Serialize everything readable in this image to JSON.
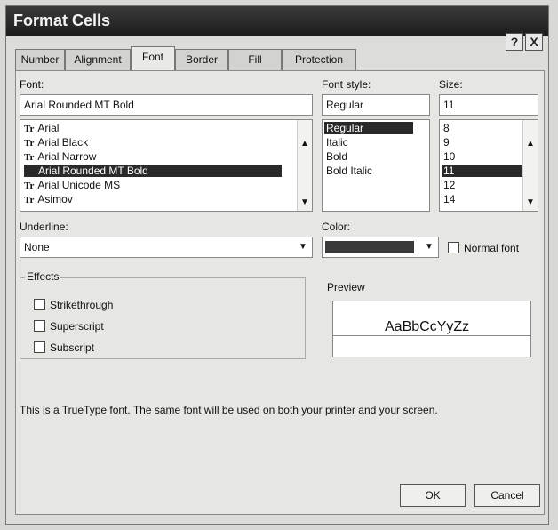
{
  "dialog": {
    "title": "Format Cells",
    "help_label": "?",
    "close_label": "X"
  },
  "tabs": [
    {
      "label": "Number"
    },
    {
      "label": "Alignment"
    },
    {
      "label": "Font"
    },
    {
      "label": "Border"
    },
    {
      "label": "Fill"
    },
    {
      "label": "Protection"
    }
  ],
  "font": {
    "label": "Font:",
    "value": "Arial Rounded MT Bold",
    "items": [
      "Arial",
      "Arial Black",
      "Arial Narrow",
      "Arial Rounded MT Bold",
      "Arial Unicode MS",
      "Asimov"
    ],
    "icon_glyph": "Tr"
  },
  "font_style": {
    "label": "Font style:",
    "value": "Regular",
    "items": [
      "Regular",
      "Italic",
      "Bold",
      "Bold Italic"
    ]
  },
  "size": {
    "label": "Size:",
    "value": "11",
    "items": [
      "8",
      "9",
      "10",
      "11",
      "12",
      "14"
    ]
  },
  "underline": {
    "label": "Underline:",
    "value": "None"
  },
  "color": {
    "label": "Color:",
    "swatch": "#3a3a3a"
  },
  "normal_font": {
    "label": "Normal font"
  },
  "effects": {
    "label": "Effects",
    "strikethrough": "Strikethrough",
    "superscript": "Superscript",
    "subscript": "Subscript"
  },
  "preview": {
    "label": "Preview",
    "sample": "AaBbCcYyZz"
  },
  "info_text": "This is a TrueType font.  The same font will be used on both your printer and your screen.",
  "buttons": {
    "ok": "OK",
    "cancel": "Cancel"
  }
}
